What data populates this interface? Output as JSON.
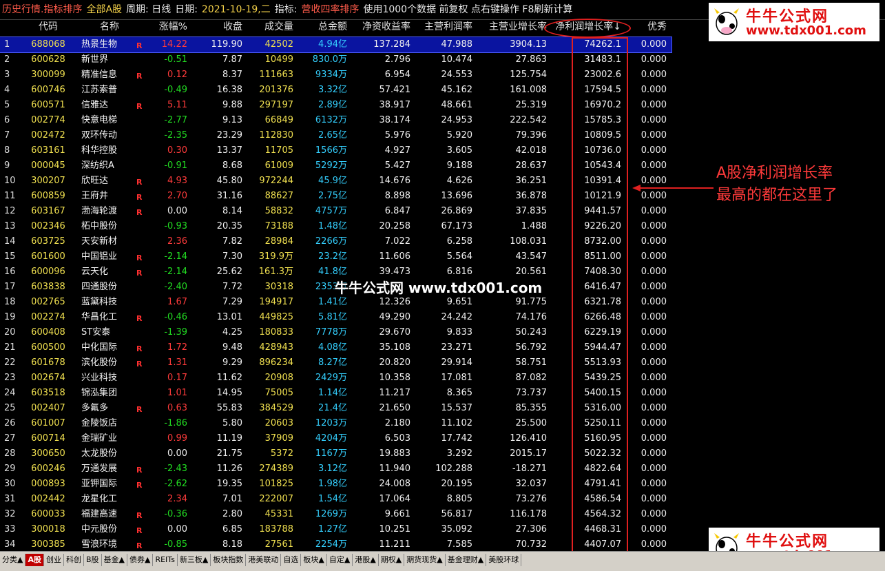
{
  "title_bar": {
    "part1": "历史行情.指标排序",
    "part2": "全部A股",
    "part3": "周期: 日线",
    "part4": "日期:",
    "date": "2021-10-19,二",
    "part5": "指标:",
    "indicator": "营收四率排序",
    "part6": "使用1000个数据 前复权 点右键操作 F8刷新计算"
  },
  "columns": {
    "code": "代码",
    "name": "名称",
    "change": "涨幅%",
    "close": "收盘",
    "volume": "成交量",
    "amount": "总金额",
    "roe": "净资收益率",
    "net_margin": "主营利润率",
    "revenue_growth": "主营业增长率",
    "profit_growth": "净利润增长率↓",
    "best": "优秀"
  },
  "rows": [
    {
      "idx": "1",
      "code": "688068",
      "name": "热景生物",
      "r": "R",
      "change": "14.22",
      "dir": "up",
      "close": "119.90",
      "volume": "42502",
      "amount": "4.94亿",
      "roe": "137.284",
      "net_margin": "47.988",
      "revenue_growth": "3904.13",
      "profit_growth": "74262.1",
      "best": "0.000"
    },
    {
      "idx": "2",
      "code": "600628",
      "name": "新世界",
      "r": "",
      "change": "-0.51",
      "dir": "down",
      "close": "7.87",
      "volume": "10499",
      "amount": "830.0万",
      "roe": "2.796",
      "net_margin": "10.474",
      "revenue_growth": "27.863",
      "profit_growth": "31483.1",
      "best": "0.000"
    },
    {
      "idx": "3",
      "code": "300099",
      "name": "精准信息",
      "r": "R",
      "change": "0.12",
      "dir": "up",
      "close": "8.37",
      "volume": "111663",
      "amount": "9334万",
      "roe": "6.954",
      "net_margin": "24.553",
      "revenue_growth": "125.754",
      "profit_growth": "23002.6",
      "best": "0.000"
    },
    {
      "idx": "4",
      "code": "600746",
      "name": "江苏索普",
      "r": "",
      "change": "-0.49",
      "dir": "down",
      "close": "16.38",
      "volume": "201376",
      "amount": "3.32亿",
      "roe": "57.421",
      "net_margin": "45.162",
      "revenue_growth": "161.008",
      "profit_growth": "17594.5",
      "best": "0.000"
    },
    {
      "idx": "5",
      "code": "600571",
      "name": "信雅达",
      "r": "R",
      "change": "5.11",
      "dir": "up",
      "close": "9.88",
      "volume": "297197",
      "amount": "2.89亿",
      "roe": "38.917",
      "net_margin": "48.661",
      "revenue_growth": "25.319",
      "profit_growth": "16970.2",
      "best": "0.000"
    },
    {
      "idx": "6",
      "code": "002774",
      "name": "快意电梯",
      "r": "",
      "change": "-2.77",
      "dir": "down",
      "close": "9.13",
      "volume": "66849",
      "amount": "6132万",
      "roe": "38.174",
      "net_margin": "24.953",
      "revenue_growth": "222.542",
      "profit_growth": "15785.3",
      "best": "0.000"
    },
    {
      "idx": "7",
      "code": "002472",
      "name": "双环传动",
      "r": "",
      "change": "-2.35",
      "dir": "down",
      "close": "23.29",
      "volume": "112830",
      "amount": "2.65亿",
      "roe": "5.976",
      "net_margin": "5.920",
      "revenue_growth": "79.396",
      "profit_growth": "10809.5",
      "best": "0.000"
    },
    {
      "idx": "8",
      "code": "603161",
      "name": "科华控股",
      "r": "",
      "change": "0.30",
      "dir": "up",
      "close": "13.37",
      "volume": "11705",
      "amount": "1566万",
      "roe": "4.927",
      "net_margin": "3.605",
      "revenue_growth": "42.018",
      "profit_growth": "10736.0",
      "best": "0.000"
    },
    {
      "idx": "9",
      "code": "000045",
      "name": "深纺织A",
      "r": "",
      "change": "-0.91",
      "dir": "down",
      "close": "8.68",
      "volume": "61009",
      "amount": "5292万",
      "roe": "5.427",
      "net_margin": "9.188",
      "revenue_growth": "28.637",
      "profit_growth": "10543.4",
      "best": "0.000"
    },
    {
      "idx": "10",
      "code": "300207",
      "name": "欣旺达",
      "r": "R",
      "change": "4.93",
      "dir": "up",
      "close": "45.80",
      "volume": "972244",
      "amount": "45.9亿",
      "roe": "14.676",
      "net_margin": "4.626",
      "revenue_growth": "36.251",
      "profit_growth": "10391.4",
      "best": "0.000"
    },
    {
      "idx": "11",
      "code": "600859",
      "name": "王府井",
      "r": "R",
      "change": "2.70",
      "dir": "up",
      "close": "31.16",
      "volume": "88627",
      "amount": "2.75亿",
      "roe": "8.898",
      "net_margin": "13.696",
      "revenue_growth": "36.878",
      "profit_growth": "10121.9",
      "best": "0.000"
    },
    {
      "idx": "12",
      "code": "603167",
      "name": "渤海轮渡",
      "r": "R",
      "change": "0.00",
      "dir": "flat",
      "close": "8.14",
      "volume": "58832",
      "amount": "4757万",
      "roe": "6.847",
      "net_margin": "26.869",
      "revenue_growth": "37.835",
      "profit_growth": "9441.57",
      "best": "0.000"
    },
    {
      "idx": "13",
      "code": "002346",
      "name": "柘中股份",
      "r": "",
      "change": "-0.93",
      "dir": "down",
      "close": "20.35",
      "volume": "73188",
      "amount": "1.48亿",
      "roe": "20.258",
      "net_margin": "67.173",
      "revenue_growth": "1.488",
      "profit_growth": "9226.20",
      "best": "0.000"
    },
    {
      "idx": "14",
      "code": "603725",
      "name": "天安新材",
      "r": "",
      "change": "2.36",
      "dir": "up",
      "close": "7.82",
      "volume": "28984",
      "amount": "2266万",
      "roe": "7.022",
      "net_margin": "6.258",
      "revenue_growth": "108.031",
      "profit_growth": "8732.00",
      "best": "0.000"
    },
    {
      "idx": "15",
      "code": "601600",
      "name": "中国铝业",
      "r": "R",
      "change": "-2.14",
      "dir": "down",
      "close": "7.30",
      "volume": "319.9万",
      "amount": "23.2亿",
      "roe": "11.606",
      "net_margin": "5.564",
      "revenue_growth": "43.547",
      "profit_growth": "8511.00",
      "best": "0.000"
    },
    {
      "idx": "16",
      "code": "600096",
      "name": "云天化",
      "r": "R",
      "change": "-2.14",
      "dir": "down",
      "close": "25.62",
      "volume": "161.3万",
      "amount": "41.8亿",
      "roe": "39.473",
      "net_margin": "6.816",
      "revenue_growth": "20.561",
      "profit_growth": "7408.30",
      "best": "0.000"
    },
    {
      "idx": "17",
      "code": "603838",
      "name": "四通股份",
      "r": "",
      "change": "-2.40",
      "dir": "down",
      "close": "7.72",
      "volume": "30318",
      "amount": "2353万",
      "roe": "",
      "net_margin": "",
      "revenue_growth": "",
      "profit_growth": "6416.47",
      "best": "0.000"
    },
    {
      "idx": "18",
      "code": "002765",
      "name": "蓝黛科技",
      "r": "",
      "change": "1.67",
      "dir": "up",
      "close": "7.29",
      "volume": "194917",
      "amount": "1.41亿",
      "roe": "12.326",
      "net_margin": "9.651",
      "revenue_growth": "91.775",
      "profit_growth": "6321.78",
      "best": "0.000"
    },
    {
      "idx": "19",
      "code": "002274",
      "name": "华昌化工",
      "r": "R",
      "change": "-0.46",
      "dir": "down",
      "close": "13.01",
      "volume": "449825",
      "amount": "5.81亿",
      "roe": "49.290",
      "net_margin": "24.242",
      "revenue_growth": "74.176",
      "profit_growth": "6266.48",
      "best": "0.000"
    },
    {
      "idx": "20",
      "code": "600408",
      "name": "ST安泰",
      "r": "",
      "change": "-1.39",
      "dir": "down",
      "close": "4.25",
      "volume": "180833",
      "amount": "7778万",
      "roe": "29.670",
      "net_margin": "9.833",
      "revenue_growth": "50.243",
      "profit_growth": "6229.19",
      "best": "0.000"
    },
    {
      "idx": "21",
      "code": "600500",
      "name": "中化国际",
      "r": "R",
      "change": "1.72",
      "dir": "up",
      "close": "9.48",
      "volume": "428943",
      "amount": "4.08亿",
      "roe": "35.108",
      "net_margin": "23.271",
      "revenue_growth": "56.792",
      "profit_growth": "5944.47",
      "best": "0.000"
    },
    {
      "idx": "22",
      "code": "601678",
      "name": "滨化股份",
      "r": "R",
      "change": "1.31",
      "dir": "up",
      "close": "9.29",
      "volume": "896234",
      "amount": "8.27亿",
      "roe": "20.820",
      "net_margin": "29.914",
      "revenue_growth": "58.751",
      "profit_growth": "5513.93",
      "best": "0.000"
    },
    {
      "idx": "23",
      "code": "002674",
      "name": "兴业科技",
      "r": "",
      "change": "0.17",
      "dir": "up",
      "close": "11.62",
      "volume": "20908",
      "amount": "2429万",
      "roe": "10.358",
      "net_margin": "17.081",
      "revenue_growth": "87.082",
      "profit_growth": "5439.25",
      "best": "0.000"
    },
    {
      "idx": "24",
      "code": "603518",
      "name": "锦泓集团",
      "r": "",
      "change": "1.01",
      "dir": "up",
      "close": "14.95",
      "volume": "75005",
      "amount": "1.14亿",
      "roe": "11.217",
      "net_margin": "8.365",
      "revenue_growth": "73.737",
      "profit_growth": "5400.15",
      "best": "0.000"
    },
    {
      "idx": "25",
      "code": "002407",
      "name": "多氟多",
      "r": "R",
      "change": "0.63",
      "dir": "up",
      "close": "55.83",
      "volume": "384529",
      "amount": "21.4亿",
      "roe": "21.650",
      "net_margin": "15.537",
      "revenue_growth": "85.355",
      "profit_growth": "5316.00",
      "best": "0.000"
    },
    {
      "idx": "26",
      "code": "601007",
      "name": "金陵饭店",
      "r": "",
      "change": "-1.86",
      "dir": "down",
      "close": "5.80",
      "volume": "20603",
      "amount": "1203万",
      "roe": "2.180",
      "net_margin": "11.102",
      "revenue_growth": "25.500",
      "profit_growth": "5250.11",
      "best": "0.000"
    },
    {
      "idx": "27",
      "code": "600714",
      "name": "金瑞矿业",
      "r": "",
      "change": "0.99",
      "dir": "up",
      "close": "11.19",
      "volume": "37909",
      "amount": "4204万",
      "roe": "6.503",
      "net_margin": "17.742",
      "revenue_growth": "126.410",
      "profit_growth": "5160.95",
      "best": "0.000"
    },
    {
      "idx": "28",
      "code": "300650",
      "name": "太龙股份",
      "r": "",
      "change": "0.00",
      "dir": "flat",
      "close": "21.75",
      "volume": "5372",
      "amount": "1167万",
      "roe": "19.883",
      "net_margin": "3.292",
      "revenue_growth": "2015.17",
      "profit_growth": "5022.32",
      "best": "0.000"
    },
    {
      "idx": "29",
      "code": "600246",
      "name": "万通发展",
      "r": "R",
      "change": "-2.43",
      "dir": "down",
      "close": "11.26",
      "volume": "274389",
      "amount": "3.12亿",
      "roe": "11.940",
      "net_margin": "102.288",
      "revenue_growth": "-18.271",
      "profit_growth": "4822.64",
      "best": "0.000"
    },
    {
      "idx": "30",
      "code": "000893",
      "name": "亚钾国际",
      "r": "R",
      "change": "-2.62",
      "dir": "down",
      "close": "19.35",
      "volume": "101825",
      "amount": "1.98亿",
      "roe": "24.008",
      "net_margin": "20.195",
      "revenue_growth": "32.037",
      "profit_growth": "4791.41",
      "best": "0.000"
    },
    {
      "idx": "31",
      "code": "002442",
      "name": "龙星化工",
      "r": "",
      "change": "2.34",
      "dir": "up",
      "close": "7.01",
      "volume": "222007",
      "amount": "1.54亿",
      "roe": "17.064",
      "net_margin": "8.805",
      "revenue_growth": "73.276",
      "profit_growth": "4586.54",
      "best": "0.000"
    },
    {
      "idx": "32",
      "code": "600033",
      "name": "福建高速",
      "r": "R",
      "change": "-0.36",
      "dir": "down",
      "close": "2.80",
      "volume": "45331",
      "amount": "1269万",
      "roe": "9.661",
      "net_margin": "56.817",
      "revenue_growth": "116.178",
      "profit_growth": "4564.32",
      "best": "0.000"
    },
    {
      "idx": "33",
      "code": "300018",
      "name": "中元股份",
      "r": "R",
      "change": "0.00",
      "dir": "flat",
      "close": "6.85",
      "volume": "183788",
      "amount": "1.27亿",
      "roe": "10.251",
      "net_margin": "35.092",
      "revenue_growth": "27.306",
      "profit_growth": "4468.31",
      "best": "0.000"
    },
    {
      "idx": "34",
      "code": "300385",
      "name": "雪浪环境",
      "r": "R",
      "change": "-0.85",
      "dir": "down",
      "close": "8.18",
      "volume": "27561",
      "amount": "2254万",
      "roe": "11.211",
      "net_margin": "7.585",
      "revenue_growth": "70.732",
      "profit_growth": "4407.07",
      "best": "0.000"
    }
  ],
  "annotation": {
    "line1": "A股净利润增长率",
    "line2": "最高的都在这里了"
  },
  "watermark": {
    "center": "牛牛公式网 www.tdx001.com",
    "logo_title": "牛牛公式网",
    "logo_url": "www.tdx001.com"
  },
  "tabs": [
    "分类▲",
    "A股",
    "创业",
    "科创",
    "B股",
    "基金▲",
    "债券▲",
    "REITs",
    "新三板▲",
    "板块指数",
    "港美联动",
    "自选",
    "板块▲",
    "自定▲",
    "港股▲",
    "期权▲",
    "期货现货▲",
    "基金理财▲",
    "美股环球"
  ],
  "active_tab_index": 1,
  "colors": {
    "up": "#ff3b3b",
    "down": "#22dd22",
    "selected_row": "#0a14a0",
    "highlight": "#e02020"
  }
}
